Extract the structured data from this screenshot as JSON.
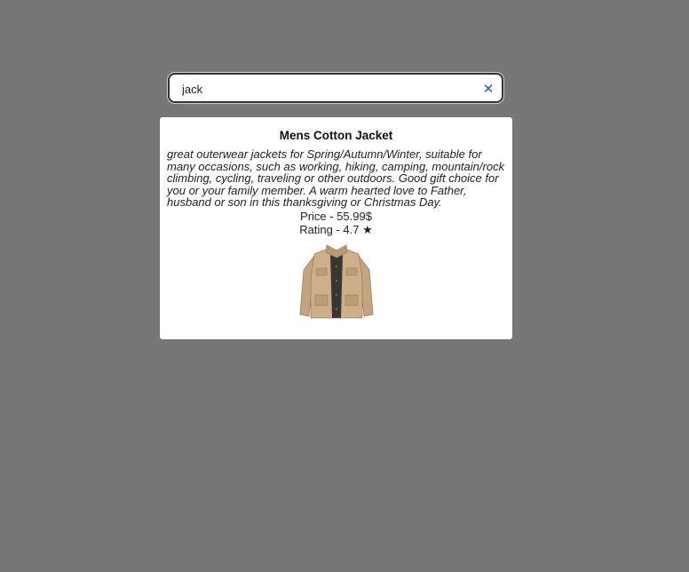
{
  "search": {
    "value": "jack",
    "clear_label": "✕"
  },
  "product": {
    "title": "Mens Cotton Jacket",
    "description": "great outerwear jackets for Spring/Autumn/Winter, suitable for many occasions, such as working, hiking, camping, mountain/rock climbing, cycling, traveling or other outdoors. Good gift choice for you or your family member. A warm hearted love to Father, husband or son in this thanksgiving or Christmas Day.",
    "price": "Price - 55.99$",
    "rating": "Rating - 4.7 ★",
    "image_icon": "jacket-image"
  },
  "colors": {
    "background": "#777777",
    "card": "#ffffff",
    "clear_icon": "#2b5b8a",
    "jacket": "#c9ad87"
  }
}
